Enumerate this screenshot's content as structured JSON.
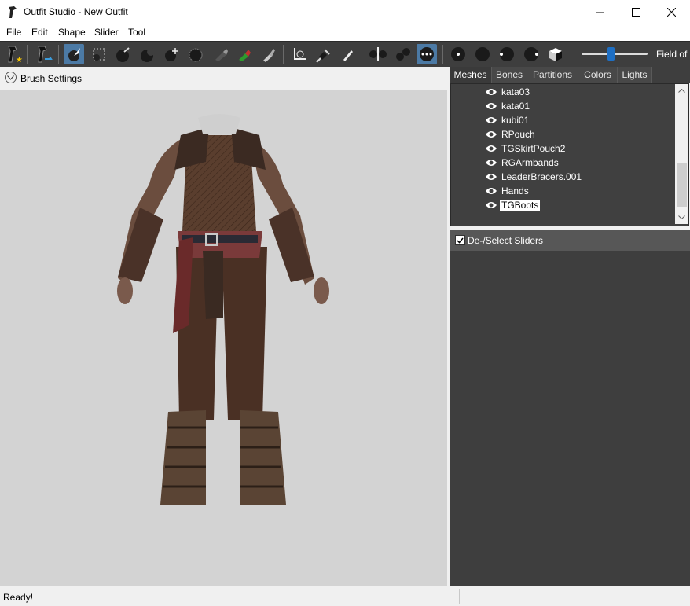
{
  "window": {
    "title": "Outfit Studio - New Outfit",
    "minimize_icon": "minimize-icon",
    "maximize_icon": "maximize-icon",
    "close_icon": "close-icon"
  },
  "menu": [
    "File",
    "Edit",
    "Shape",
    "Slider",
    "Tool"
  ],
  "toolbar": {
    "buttons": [
      "new-project-icon",
      "load-outfit-icon",
      "select-brush-icon",
      "mask-brush-icon",
      "inflate-brush-icon",
      "deflate-brush-icon",
      "move-brush-icon",
      "smooth-brush-icon",
      "undiff-brush-icon",
      "weight-brush-icon",
      "color-brush-icon",
      "transform-tool-icon",
      "pivot-tool-icon",
      "vertex-edit-icon",
      "mirror-x-icon",
      "connected-only-icon",
      "vertices-toggle-icon",
      "view-front-icon",
      "view-back-icon",
      "view-left-icon",
      "view-right-icon",
      "perspective-cube-icon"
    ],
    "fov_label": "Field of",
    "fov_value": 0.45,
    "accent_color": "#4c7aa5"
  },
  "brush_settings": {
    "label": "Brush Settings"
  },
  "viewport": {
    "background": "#d3d3d3",
    "content": "3D character model wearing leather armor"
  },
  "tabs": [
    "Meshes",
    "Bones",
    "Partitions",
    "Colors",
    "Lights"
  ],
  "meshes": [
    {
      "name": "kata03"
    },
    {
      "name": "kata01"
    },
    {
      "name": "kubi01"
    },
    {
      "name": "RPouch"
    },
    {
      "name": "TGSkirtPouch2"
    },
    {
      "name": "RGArmbands"
    },
    {
      "name": "LeaderBracers.001"
    },
    {
      "name": "Hands"
    },
    {
      "name": "TGBoots"
    }
  ],
  "sliders": {
    "label": "De-/Select Sliders",
    "checked": true
  },
  "status": {
    "text": "Ready!"
  }
}
